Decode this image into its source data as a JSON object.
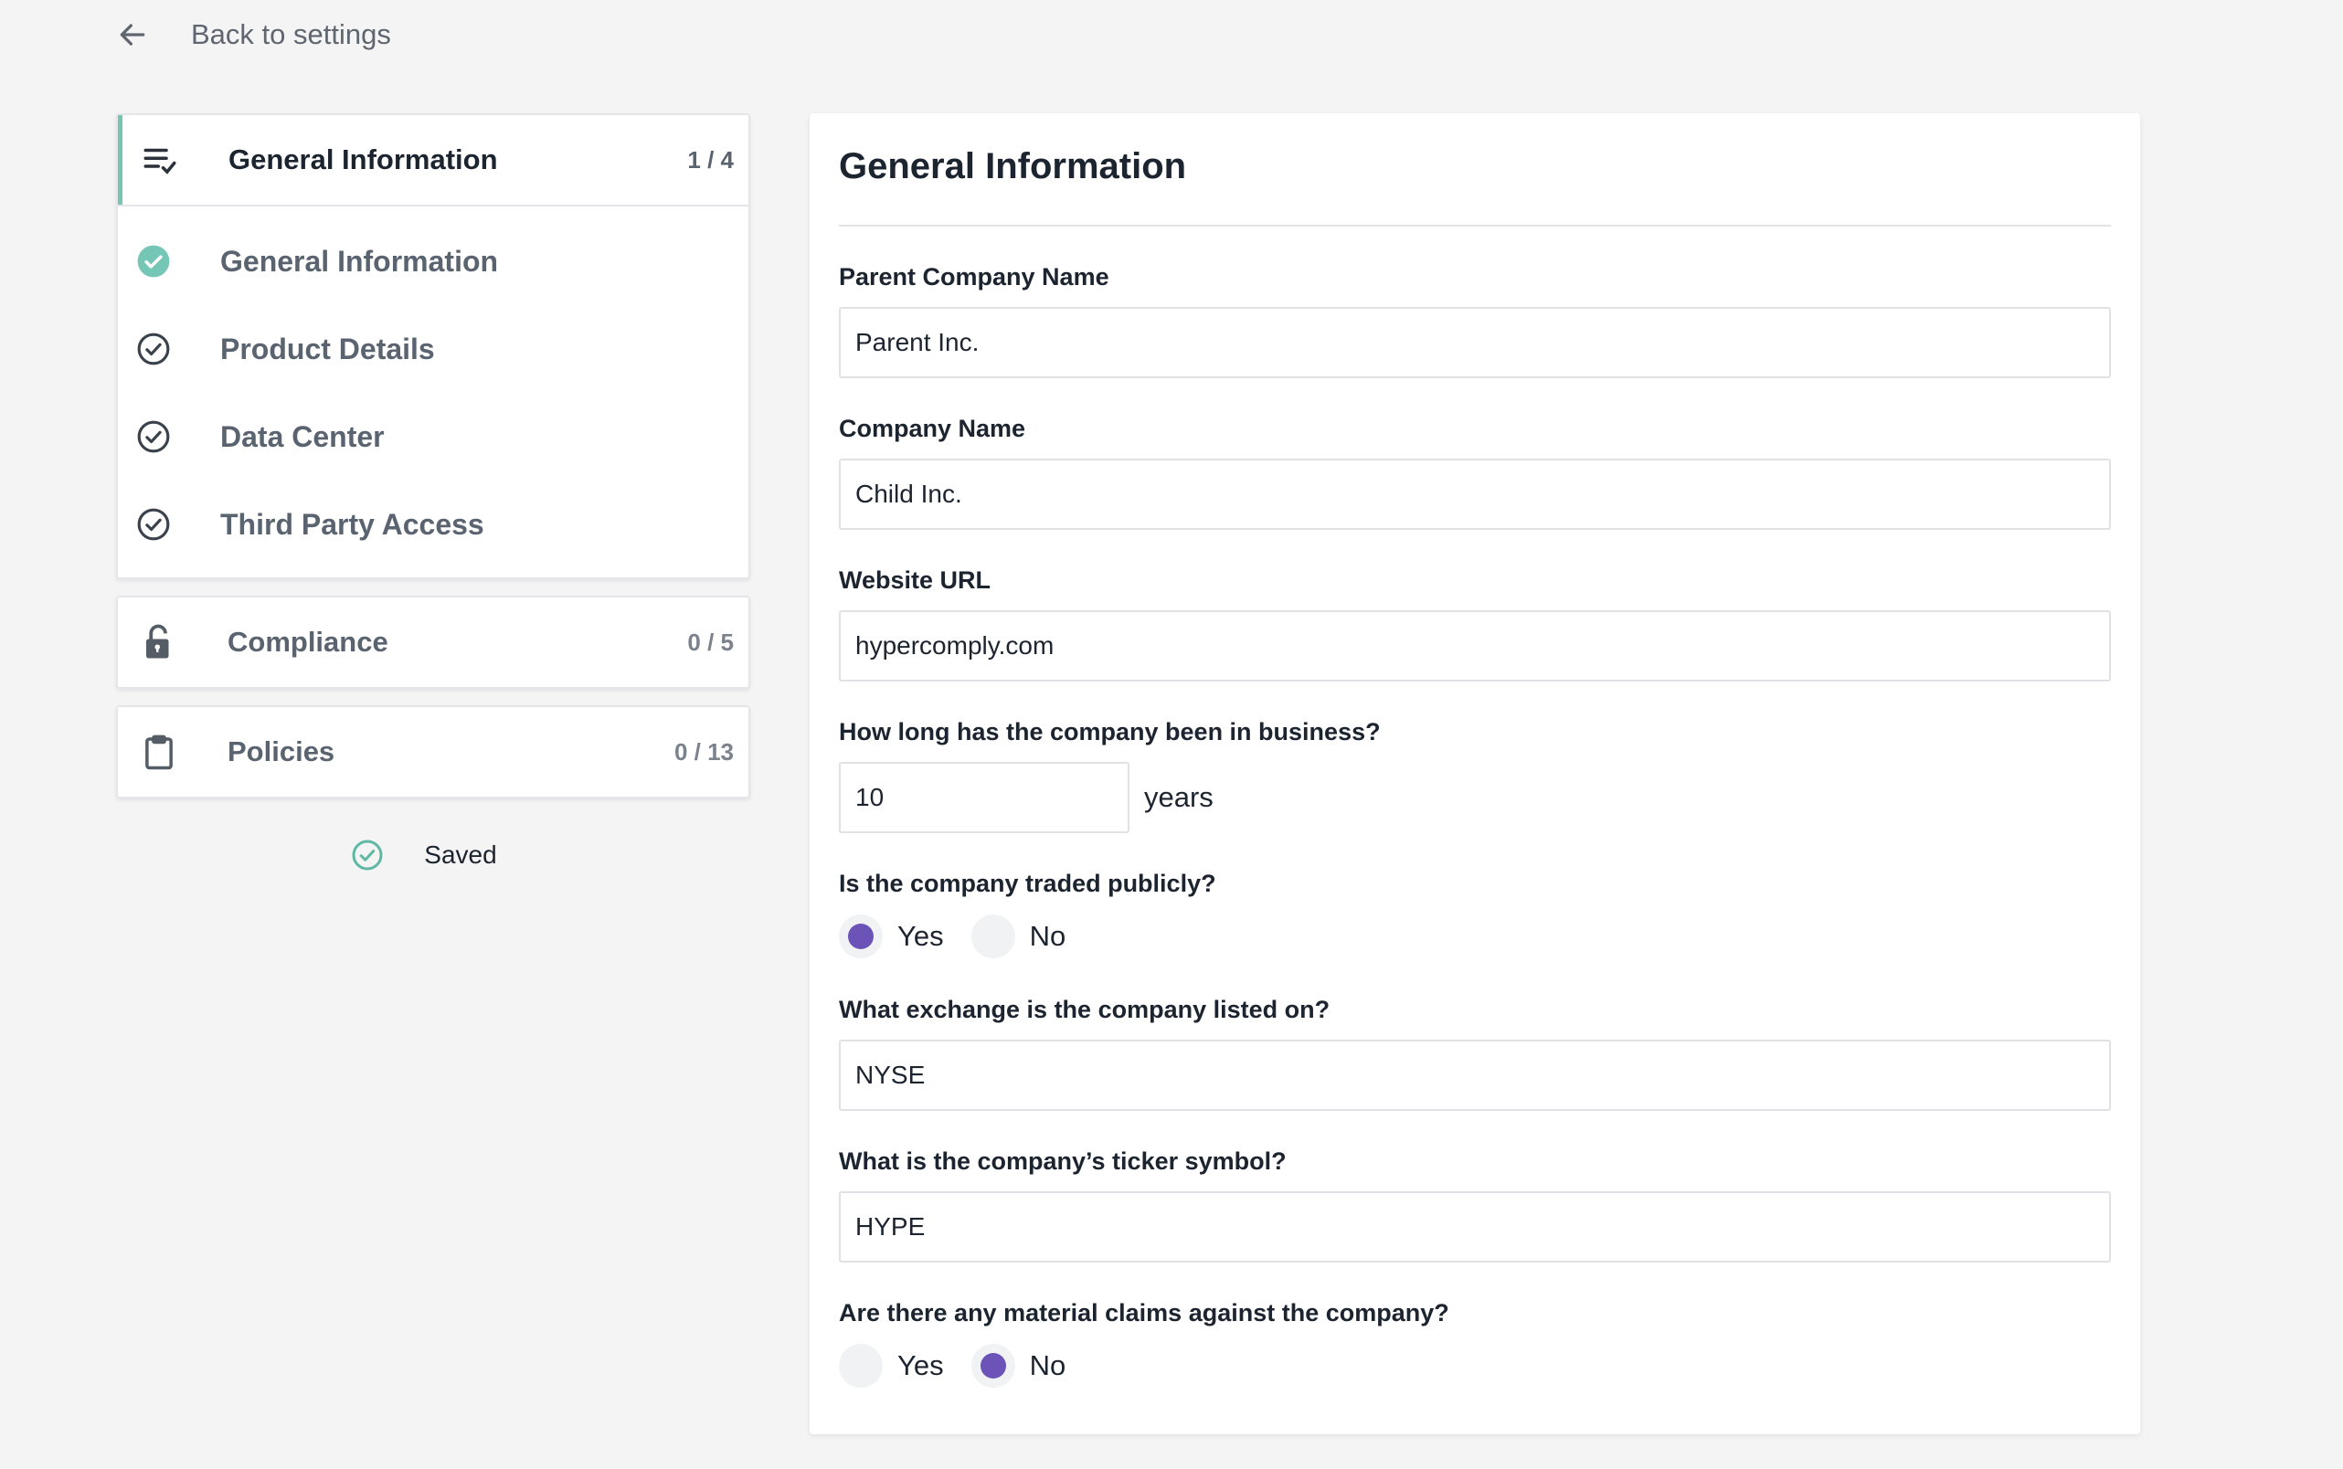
{
  "back_link": {
    "label": "Back to settings"
  },
  "sidebar": {
    "sections": [
      {
        "title": "General Information",
        "count": "1 / 4",
        "icon": "checklist-icon",
        "active": true,
        "items": [
          {
            "label": "General Information",
            "status": "complete"
          },
          {
            "label": "Product Details",
            "status": "pending"
          },
          {
            "label": "Data Center",
            "status": "pending"
          },
          {
            "label": "Third Party Access",
            "status": "pending"
          }
        ]
      },
      {
        "title": "Compliance",
        "count": "0 / 5",
        "icon": "unlock-icon"
      },
      {
        "title": "Policies",
        "count": "0 / 13",
        "icon": "clipboard-icon"
      }
    ],
    "saved_label": "Saved"
  },
  "form": {
    "title": "General Information",
    "parent_company": {
      "label": "Parent Company Name",
      "value": "Parent Inc."
    },
    "company_name": {
      "label": "Company Name",
      "value": "Child Inc."
    },
    "website": {
      "label": "Website URL",
      "value": "hypercomply.com"
    },
    "years": {
      "label": "How long has the company been in business?",
      "value": "10",
      "unit": "years"
    },
    "traded_publicly": {
      "label": "Is the company traded publicly?",
      "yes": "Yes",
      "no": "No",
      "selected": "Yes"
    },
    "exchange": {
      "label": "What exchange is the company listed on?",
      "value": "NYSE"
    },
    "ticker": {
      "label": "What is the company’s ticker symbol?",
      "value": "HYPE"
    },
    "claims": {
      "label": "Are there any material claims against the company?",
      "yes": "Yes",
      "no": "No",
      "selected": "No"
    }
  },
  "colors": {
    "accent": "#76c6b5",
    "radio_selected": "#6b53b8",
    "check_done": "#76c6b5"
  }
}
